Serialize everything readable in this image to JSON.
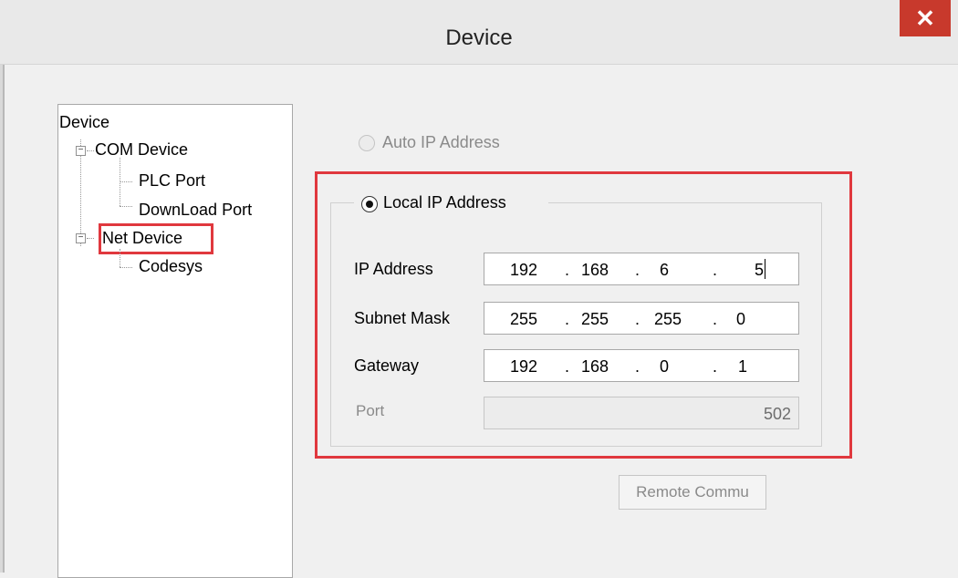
{
  "window": {
    "title": "Device"
  },
  "tree": {
    "root": "Device",
    "com_device": "COM Device",
    "plc_port": "PLC Port",
    "download_port": "DownLoad Port",
    "net_device": "Net Device",
    "codesys": "Codesys"
  },
  "ip_mode": {
    "auto_label": "Auto IP Address",
    "local_label": "Local IP Address",
    "selected": "Local IP Address"
  },
  "fields": {
    "ip_address": {
      "label": "IP Address",
      "octets": [
        "192",
        "168",
        "6",
        "5"
      ]
    },
    "subnet_mask": {
      "label": "Subnet Mask",
      "octets": [
        "255",
        "255",
        "255",
        "0"
      ]
    },
    "gateway": {
      "label": "Gateway",
      "octets": [
        "192",
        "168",
        "0",
        "1"
      ]
    },
    "port": {
      "label": "Port",
      "value": "502"
    }
  },
  "remote_button": "Remote Commu",
  "colors": {
    "highlight": "#e0383e",
    "close": "#c8392c"
  },
  "icons": {
    "close": "close-icon",
    "expander": "tree-expander-icon"
  }
}
